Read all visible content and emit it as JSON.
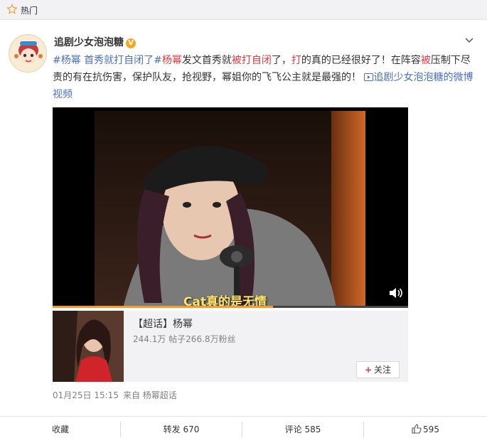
{
  "header": {
    "label": "热门",
    "icon": "star-icon"
  },
  "post": {
    "username": "追剧少女泡泡糖",
    "verified_badge": "V",
    "text_segments": [
      {
        "text": "#杨幂 首秀就打自闭了#",
        "style": "blue"
      },
      {
        "text": "杨幂",
        "style": "red"
      },
      {
        "text": "发文首秀就",
        "style": "normal"
      },
      {
        "text": "被打自闭",
        "style": "red"
      },
      {
        "text": "了，",
        "style": "normal"
      },
      {
        "text": "打",
        "style": "red"
      },
      {
        "text": "的真的已经很好了！在阵容",
        "style": "normal"
      },
      {
        "text": "被",
        "style": "red"
      },
      {
        "text": "压制下尽责的有在抗伤害，保护队友，抢视野，幂姐你的飞飞公主就是最强的！",
        "style": "normal"
      }
    ],
    "video_link": "追剧少女泡泡糖的微博视频",
    "video": {
      "caption": "Cat真的是无情",
      "progress": 0.62,
      "icon": "speaker-icon"
    },
    "topic_card": {
      "title": "【超话】杨幂",
      "stats": "244.1万 帖子266.8万粉丝",
      "follow_label": "关注"
    },
    "timestamp": "01月25日 15:15",
    "source": "来自 杨幂超话"
  },
  "actions": {
    "collect": "收藏",
    "repost": "转发 670",
    "comment": "评论 585",
    "like": "595"
  }
}
